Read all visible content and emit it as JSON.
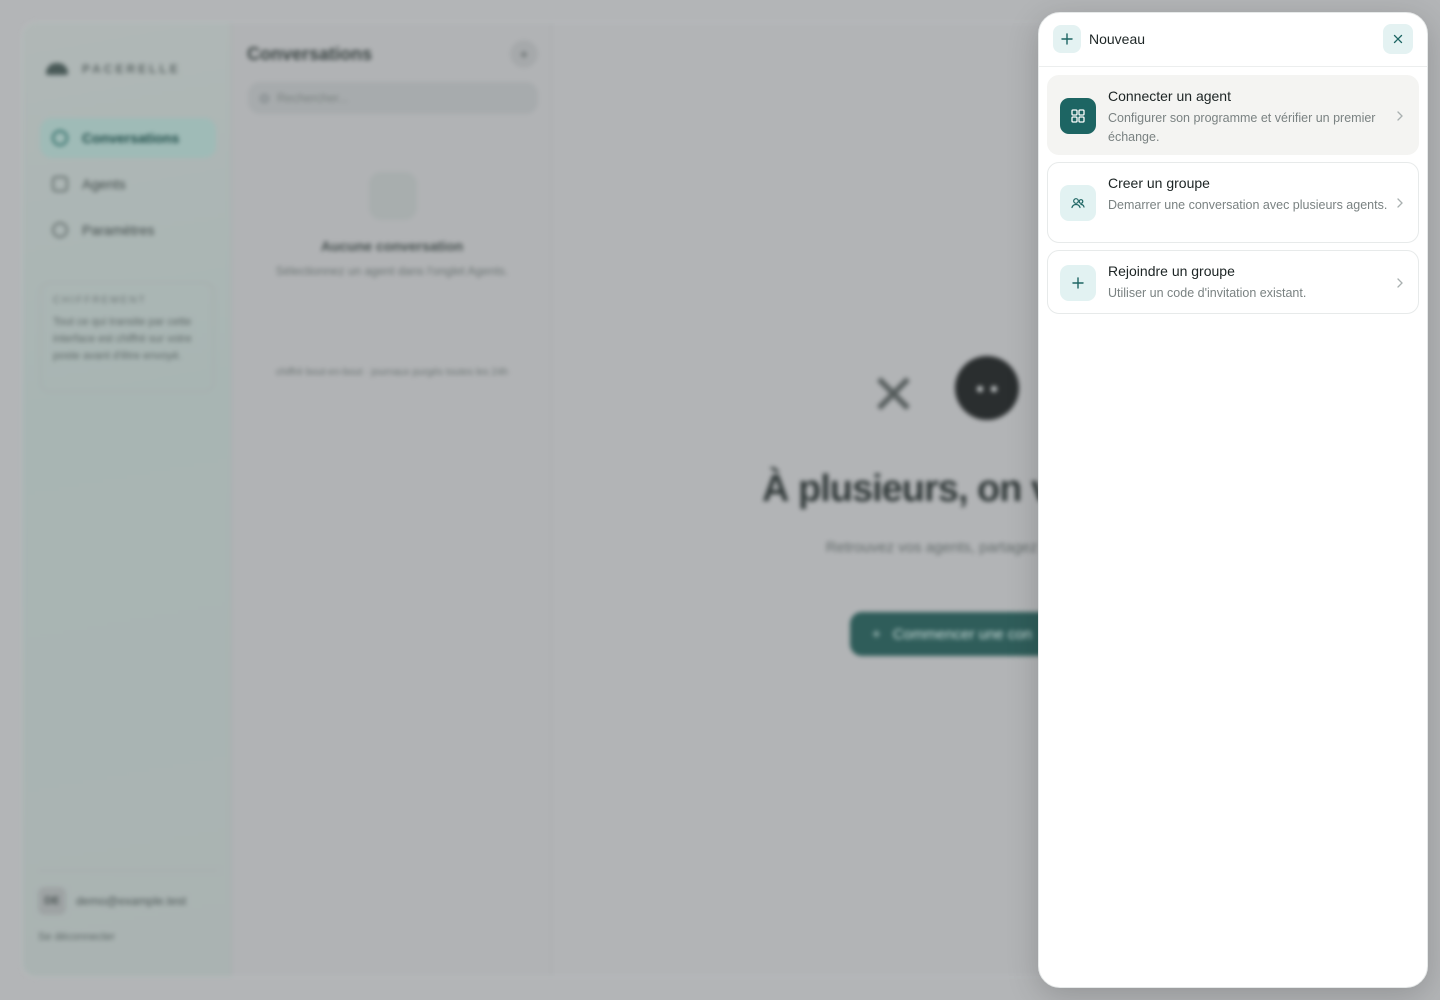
{
  "background": {
    "brand": "PACERELLE",
    "nav": [
      {
        "label": "Conversations",
        "icon": "chat-icon",
        "active": true
      },
      {
        "label": "Agents",
        "icon": "grid-icon",
        "active": false
      },
      {
        "label": "Paramètres",
        "icon": "gear-icon",
        "active": false
      }
    ],
    "cipher": {
      "title": "CHIFFREMENT",
      "text": "Tout ce qui transite par cette interface est chiffré sur votre poste avant d'être envoyé."
    },
    "user": {
      "initials": "DE",
      "email": "demo@example.test",
      "logout": "Se déconnecter"
    },
    "conversations": {
      "title": "Conversations",
      "add": "+",
      "search_placeholder": "Rechercher...",
      "empty_title": "Aucune conversation",
      "empty_sub": "Sélectionnez un agent dans l'onglet Agents.",
      "note": "chiffré bout-en-bout · journaux purgés toutes les 24h"
    },
    "hero": {
      "title": "À plusieurs, on va",
      "subtitle": "Retrouvez vos agents, partagez avancer votre prochain",
      "cta": "Commencer une con"
    }
  },
  "drawer": {
    "title": "Nouveau",
    "options": [
      {
        "title": "Connecter un agent",
        "description": "Configurer son programme et vérifier un premier échange.",
        "icon": "grid-icon"
      },
      {
        "title": "Creer un groupe",
        "description": "Demarrer une conversation avec plusieurs agents.",
        "icon": "users-icon"
      },
      {
        "title": "Rejoindre un groupe",
        "description": "Utiliser un code d'invitation existant.",
        "icon": "plus-icon"
      }
    ]
  },
  "colors": {
    "accent": "#1d6563",
    "accent_soft": "#e2f2f2",
    "overlay": "#b3b5b7"
  }
}
